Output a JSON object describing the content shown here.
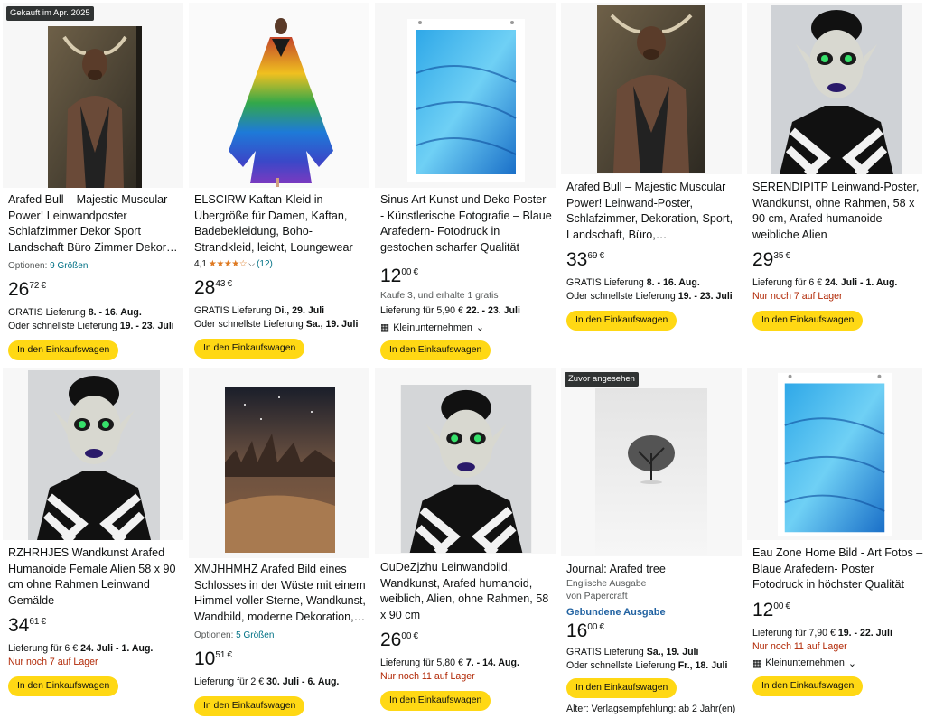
{
  "products": [
    {
      "badge": "Gekauft im Apr. 2025",
      "title": "Arafed Bull – Majestic Muscular Power! Leinwandposter Schlafzimmer Dekor Sport Landschaft Büro Zimmer Dekor…",
      "options_label": "Optionen:",
      "options_link": "9 Größen",
      "price_whole": "26",
      "price_fraction": "72",
      "currency": "€",
      "delivery_line1_prefix": "GRATIS Lieferung",
      "delivery_line1_date": "8. - 16. Aug.",
      "delivery_line2_prefix": "Oder schnellste Lieferung",
      "delivery_line2_date": "19. - 23. Juli",
      "button": "In den Einkaufswagen"
    },
    {
      "title": "ELSCIRW Kaftan-Kleid in Übergröße für Damen, Kaftan, Badebekleidung, Boho-Strandkleid, leicht, Loungewear",
      "rating_value": "4,1",
      "rating_stars": "★★★★☆",
      "rating_count": "(12)",
      "price_whole": "28",
      "price_fraction": "43",
      "currency": "€",
      "delivery_line1_prefix": "GRATIS Lieferung",
      "delivery_line1_date": "Di., 29. Juli",
      "delivery_line2_prefix": "Oder schnellste Lieferung",
      "delivery_line2_date": "Sa., 19. Juli",
      "button": "In den Einkaufswagen"
    },
    {
      "title": "Sinus Art Kunst und Deko Poster - Künstlerische Fotografie – Blaue Arafedern- Fotodruck in gestochen scharfer Qualität",
      "price_whole": "12",
      "price_fraction": "00",
      "currency": "€",
      "promo": "Kaufe 3, und erhalte 1 gratis",
      "delivery_line1_prefix": "Lieferung für 5,90 €",
      "delivery_line1_date": "22. - 23. Juli",
      "business": "Kleinunternehmen",
      "button": "In den Einkaufswagen"
    },
    {
      "title": "Arafed Bull – Majestic Muscular Power! Leinwand-Poster, Schlafzimmer, Dekoration, Sport, Landschaft, Büro, Raumdekoratio…",
      "price_whole": "33",
      "price_fraction": "69",
      "currency": "€",
      "delivery_line1_prefix": "GRATIS Lieferung",
      "delivery_line1_date": "8. - 16. Aug.",
      "delivery_line2_prefix": "Oder schnellste Lieferung",
      "delivery_line2_date": "19. - 23. Juli",
      "button": "In den Einkaufswagen"
    },
    {
      "title": "SERENDIPITP Leinwand-Poster, Wandkunst, ohne Rahmen, 58 x 90 cm, Arafed humanoide weibliche Alien",
      "price_whole": "29",
      "price_fraction": "35",
      "currency": "€",
      "delivery_line1_prefix": "Lieferung für 6 €",
      "delivery_line1_date": "24. Juli - 1. Aug.",
      "stock": "Nur noch 7 auf Lager",
      "button": "In den Einkaufswagen"
    },
    {
      "title": "RZHRHJES Wandkunst Arafed Humanoide Female Alien 58 x 90 cm ohne Rahmen Leinwand Gemälde",
      "price_whole": "34",
      "price_fraction": "61",
      "currency": "€",
      "delivery_line1_prefix": "Lieferung für 6 €",
      "delivery_line1_date": "24. Juli - 1. Aug.",
      "stock": "Nur noch 7 auf Lager",
      "button": "In den Einkaufswagen"
    },
    {
      "title": "XMJHHMHZ Arafed Bild eines Schlosses in der Wüste mit einem Himmel voller Sterne, Wandkunst, Wandbild, moderne Dekoration,…",
      "options_label": "Optionen:",
      "options_link": "5 Größen",
      "price_whole": "10",
      "price_fraction": "51",
      "currency": "€",
      "delivery_line1_prefix": "Lieferung für 2 €",
      "delivery_line1_date": "30. Juli - 6. Aug.",
      "button": "In den Einkaufswagen"
    },
    {
      "title": "OuDeZjzhu Leinwandbild, Wandkunst, Arafed humanoid, weiblich, Alien, ohne Rahmen, 58 x 90 cm",
      "price_whole": "26",
      "price_fraction": "00",
      "currency": "€",
      "delivery_line1_prefix": "Lieferung für 5,80 €",
      "delivery_line1_date": "7. - 14. Aug.",
      "stock": "Nur noch 11 auf Lager",
      "button": "In den Einkaufswagen"
    },
    {
      "badge": "Zuvor angesehen",
      "title": "Journal: Arafed tree",
      "subtitle1": "Englische Ausgabe",
      "subtitle2": "von Papercraft",
      "binding": "Gebundene Ausgabe",
      "price_whole": "16",
      "price_fraction": "00",
      "currency": "€",
      "delivery_line1_prefix": "GRATIS Lieferung",
      "delivery_line1_date": "Sa., 19. Juli",
      "delivery_line2_prefix": "Oder schnellste Lieferung",
      "delivery_line2_date": "Fr., 18. Juli",
      "button": "In den Einkaufswagen",
      "age": "Alter: Verlagsempfehlung: ab 2 Jahr(en)"
    },
    {
      "title": "Eau Zone Home Bild - Art Fotos – Blaue Arafedern- Poster Fotodruck in höchster Qualität",
      "price_whole": "12",
      "price_fraction": "00",
      "currency": "€",
      "delivery_line1_prefix": "Lieferung für 7,90 €",
      "delivery_line1_date": "19. - 22. Juli",
      "stock": "Nur noch 11 auf Lager",
      "business": "Kleinunternehmen",
      "button": "In den Einkaufswagen"
    }
  ]
}
